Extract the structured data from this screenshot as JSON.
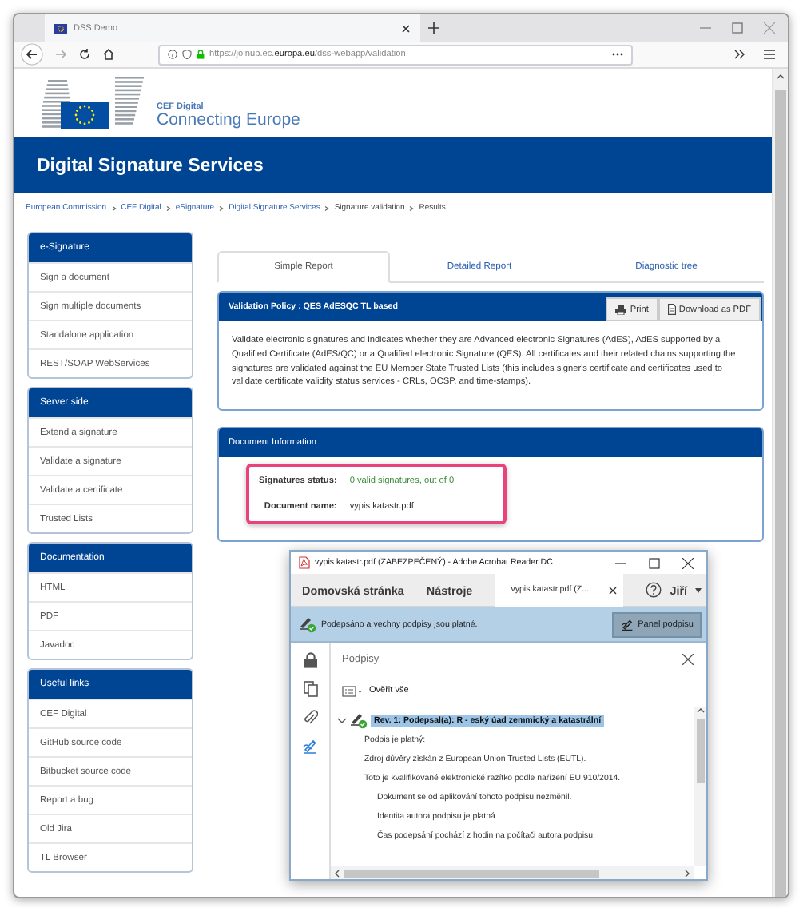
{
  "browser": {
    "tab_title": "DSS Demo",
    "url_prefix": "https://joinup.ec.",
    "url_domain": "europa.eu",
    "url_path": "/dss-webapp/validation"
  },
  "site": {
    "logo_small": "CEF Digital",
    "logo_large": "Connecting Europe",
    "banner": "Digital Signature Services",
    "breadcrumb": [
      {
        "label": "European Commission",
        "link": true
      },
      {
        "label": "CEF Digital",
        "link": true
      },
      {
        "label": "eSignature",
        "link": true
      },
      {
        "label": "Digital Signature Services",
        "link": true
      },
      {
        "label": "Signature validation",
        "link": false
      },
      {
        "label": "Results",
        "link": false
      }
    ]
  },
  "sidebar": [
    {
      "title": "e-Signature",
      "items": [
        "Sign a document",
        "Sign multiple documents",
        "Standalone application",
        "REST/SOAP WebServices"
      ]
    },
    {
      "title": "Server side",
      "items": [
        "Extend a signature",
        "Validate a signature",
        "Validate a certificate",
        "Trusted Lists"
      ]
    },
    {
      "title": "Documentation",
      "items": [
        "HTML",
        "PDF",
        "Javadoc"
      ]
    },
    {
      "title": "Useful links",
      "items": [
        "CEF Digital",
        "GitHub source code",
        "Bitbucket source code",
        "Report a bug",
        "Old Jira",
        "TL Browser"
      ]
    }
  ],
  "report": {
    "tabs": [
      {
        "label": "Simple Report",
        "selected": true
      },
      {
        "label": "Detailed Report",
        "selected": false
      },
      {
        "label": "Diagnostic tree",
        "selected": false
      }
    ],
    "policy": {
      "title": "Validation Policy : QES AdESQC TL based",
      "buttons": [
        {
          "label": "Print",
          "kind": "print"
        },
        {
          "label": "Download as PDF",
          "kind": "pdf"
        }
      ],
      "description": "Validate electronic signatures and indicates whether they are Advanced electronic Signatures (AdES), AdES supported by a Qualified Certificate (AdES/QC) or a Qualified electronic Signature (QES). All certificates and their related chains supporting the signatures are validated against the EU Member State Trusted Lists (this includes signer's certificate and certificates used to validate certificate validity status services - CRLs, OCSP, and time-stamps)."
    },
    "document_info": {
      "title": "Document Information",
      "fields": [
        {
          "label": "Signatures status:",
          "value": "0 valid signatures, out of 0",
          "kind": "status"
        },
        {
          "label": "Document name:",
          "value": "vypis katastr.pdf",
          "kind": "plain"
        }
      ]
    }
  },
  "acrobat": {
    "title": "vypis katastr.pdf (ZABEZPEČENÝ) - Adobe Acrobat Reader DC",
    "menu": [
      "Domovská stránka",
      "Nástroje"
    ],
    "doc_tab": "vypis katastr.pdf (Z...",
    "user": "Jiří",
    "signature_bar": {
      "message": "Podepsáno a vechny podpisy jsou platné.",
      "button": "Panel podpisu"
    },
    "rail": [
      {
        "kind": "lock",
        "selected": false
      },
      {
        "kind": "pages",
        "selected": false
      },
      {
        "kind": "attachment",
        "selected": false
      },
      {
        "kind": "signature",
        "selected": true
      }
    ],
    "panel_title": "Podpisy",
    "verify_all": "Ověřit vše",
    "signature": {
      "label": "Rev. 1: Podepsal(a): R - eský úad zemmický a katastrální",
      "expanded": true,
      "selected": true,
      "details": [
        {
          "text": "Podpis je platný:"
        },
        {
          "text": "Zdroj důvěry získán z European Union Trusted Lists (EUTL)."
        },
        {
          "text": "Toto je kvalifikované elektronické razítko podle nařízení EU 910/2014.",
          "children": [
            {
              "text": "Dokument se od aplikování tohoto podpisu nezměnil."
            },
            {
              "text": "Identita autora podpisu je platná."
            },
            {
              "text": "Čas podepsání pochází z hodin na počítači autora podpisu."
            }
          ]
        }
      ]
    }
  }
}
